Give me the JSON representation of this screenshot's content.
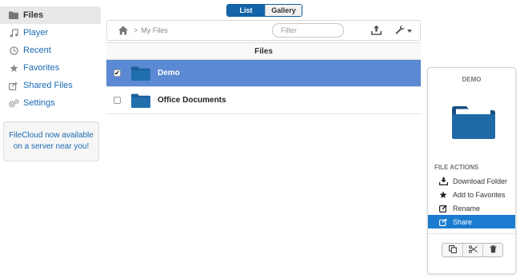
{
  "sidebar": {
    "items": [
      {
        "label": "Files",
        "icon": "folder-icon",
        "active": true
      },
      {
        "label": "Player",
        "icon": "music-icon"
      },
      {
        "label": "Recent",
        "icon": "clock-icon"
      },
      {
        "label": "Favorites",
        "icon": "star-icon"
      },
      {
        "label": "Shared Files",
        "icon": "share-icon"
      },
      {
        "label": "Settings",
        "icon": "gears-icon"
      }
    ],
    "promo": "FileCloud now available on a server near you!"
  },
  "view_toggle": {
    "list": "List",
    "gallery": "Gallery",
    "selected": "List"
  },
  "toolbar": {
    "breadcrumb_separator": ">",
    "breadcrumb_current": "My Files",
    "filter_placeholder": "Filter"
  },
  "files": {
    "header": "Files",
    "rows": [
      {
        "name": "Demo",
        "selected": true
      },
      {
        "name": "Office Documents",
        "selected": false
      }
    ]
  },
  "panel": {
    "title": "DEMO",
    "section": "FILE ACTIONS",
    "actions": [
      {
        "label": "Download Folder",
        "icon": "download-icon"
      },
      {
        "label": "Add to Favorites",
        "icon": "star-icon"
      },
      {
        "label": "Rename",
        "icon": "edit-icon"
      },
      {
        "label": "Share",
        "icon": "share-icon",
        "active": true
      }
    ]
  },
  "colors": {
    "accent": "#1263a8",
    "selected_row": "#5b89d3",
    "active_action": "#1a7bd0",
    "folder": "#1c5f99",
    "link": "#1a6ab3"
  }
}
